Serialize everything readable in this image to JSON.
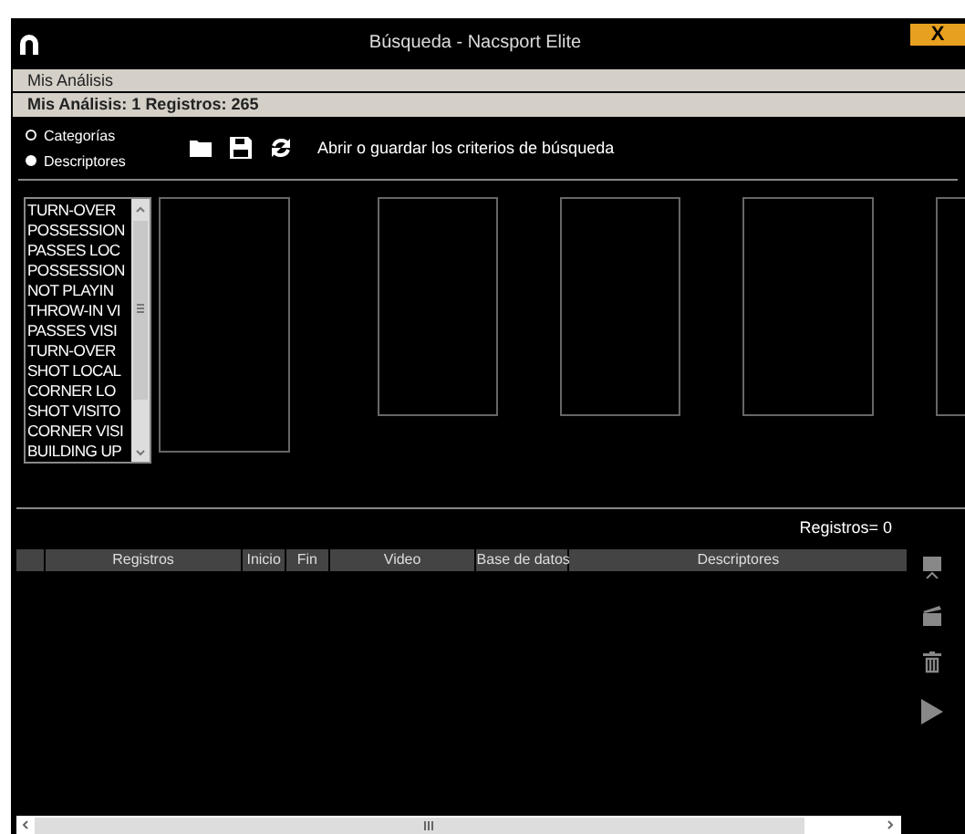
{
  "window": {
    "title": "Búsqueda - Nacsport Elite",
    "close_label": "X"
  },
  "analysis_bar": {
    "label": "Mis Análisis"
  },
  "summary_bar": {
    "label": "Mis Análisis: 1 Registros: 265"
  },
  "mode_options": [
    {
      "label": "Categorías",
      "selected": false
    },
    {
      "label": "Descriptores",
      "selected": true
    }
  ],
  "toolbar": {
    "hint": "Abrir o guardar los criterios de búsqueda"
  },
  "category_list": [
    "TURN-OVER",
    "POSSESSION",
    "PASSES LOC",
    "POSSESSION",
    "NOT PLAYIN",
    "THROW-IN VI",
    "PASSES VISI",
    "TURN-OVER",
    "SHOT LOCAL",
    "CORNER LO",
    "SHOT VISITO",
    "CORNER VISI",
    "BUILDING UP"
  ],
  "records_count": "Registros= 0",
  "table": {
    "columns": [
      "",
      "Registros",
      "Inicio",
      "Fin",
      "Video",
      "Base de datos",
      "Descriptores"
    ]
  }
}
